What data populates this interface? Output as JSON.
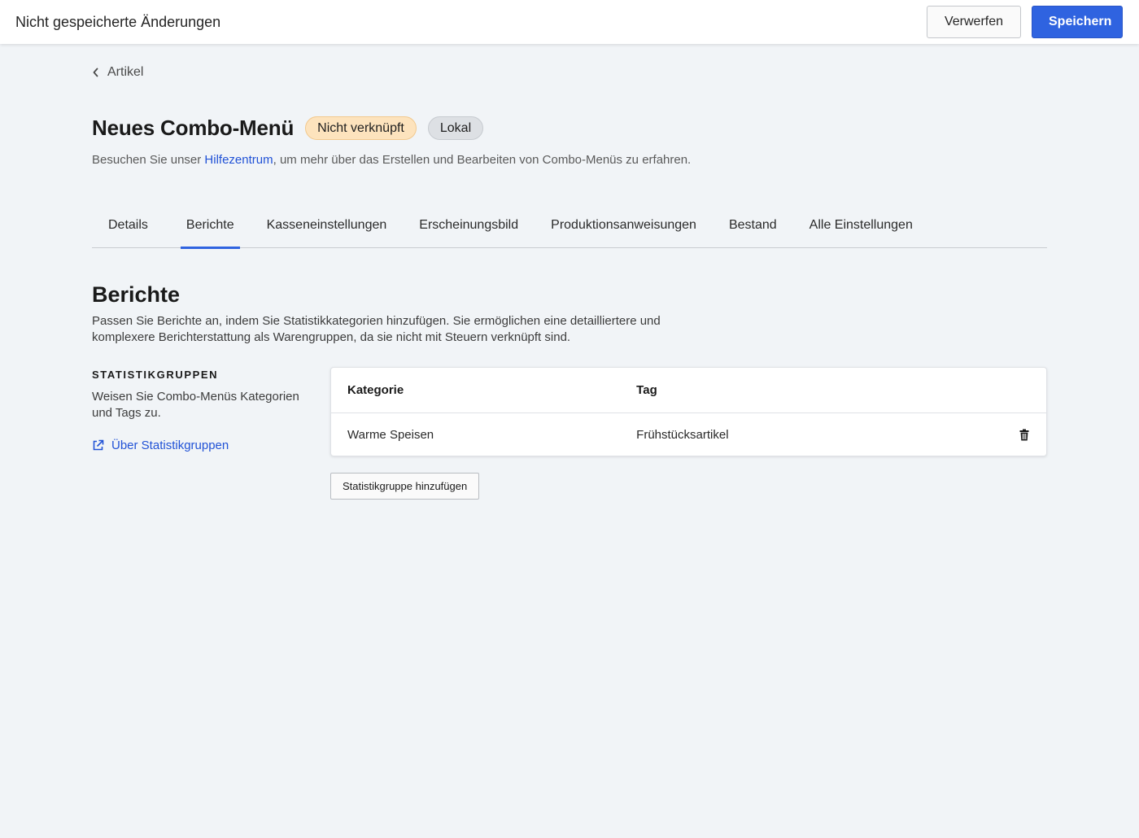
{
  "topbar": {
    "title": "Nicht gespeicherte Änderungen",
    "discard_label": "Verwerfen",
    "save_label": "Speichern"
  },
  "breadcrumb": {
    "label": "Artikel"
  },
  "header": {
    "title": "Neues Combo-Menü",
    "badges": [
      "Nicht verknüpft",
      "Lokal"
    ],
    "help_prefix": "Besuchen Sie unser ",
    "help_link": "Hilfezentrum",
    "help_suffix": ", um mehr über das Erstellen und Bearbeiten von Combo-Menüs zu erfahren."
  },
  "tabs": [
    {
      "label": "Details",
      "active": false
    },
    {
      "label": "Berichte",
      "active": true
    },
    {
      "label": "Kasseneinstellungen",
      "active": false
    },
    {
      "label": "Erscheinungsbild",
      "active": false
    },
    {
      "label": "Produktionsanweisungen",
      "active": false
    },
    {
      "label": "Bestand",
      "active": false
    },
    {
      "label": "Alle Einstellungen",
      "active": false
    }
  ],
  "section": {
    "title": "Berichte",
    "description": "Passen Sie Berichte an, indem Sie Statistikkategorien hinzufügen. Sie ermöglichen eine detailliertere und komplexere Berichterstattung als Warengruppen, da sie nicht mit Steuern verknüpft sind."
  },
  "stat_groups": {
    "label": "STATISTIKGRUPPEN",
    "description": "Weisen Sie Combo-Menüs Kategorien und Tags zu.",
    "link": "Über Statistikgruppen",
    "table": {
      "headers": [
        "Kategorie",
        "Tag"
      ],
      "rows": [
        {
          "category": "Warme Speisen",
          "tag": "Frühstücksartikel"
        }
      ]
    },
    "add_button": "Statistikgruppe hinzufügen"
  },
  "colors": {
    "primary": "#2f63e0",
    "link": "#2152d6",
    "badge_warn_bg": "#fde3bd",
    "badge_gray_bg": "#dde0e4",
    "background": "#f1f4f7"
  }
}
